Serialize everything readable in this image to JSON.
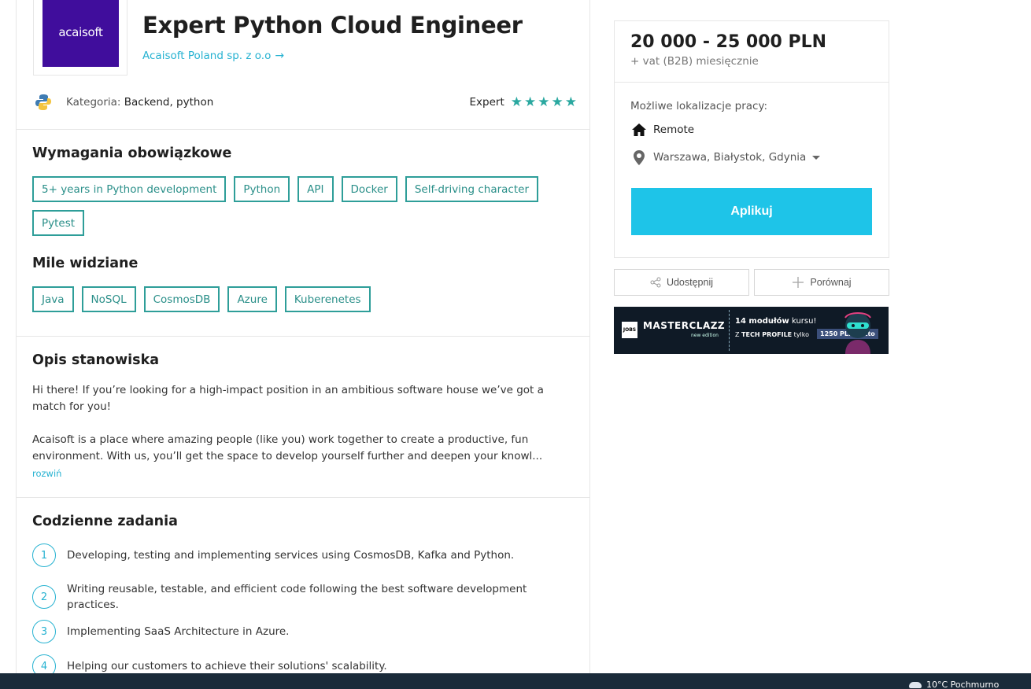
{
  "job": {
    "logo_text": "acaisoft",
    "title": "Expert Python Cloud Engineer",
    "company": "Acaisoft Poland sp. z o.o",
    "category_label": "Kategoria:",
    "category_value": "Backend, python",
    "level": "Expert",
    "level_stars": 5
  },
  "requirements": {
    "title": "Wymagania obowiązkowe",
    "tags": [
      "5+ years in Python development",
      "Python",
      "API",
      "Docker",
      "Self-driving character",
      "Pytest"
    ]
  },
  "nice_to_have": {
    "title": "Mile widziane",
    "tags": [
      "Java",
      "NoSQL",
      "CosmosDB",
      "Azure",
      "Kuberenetes"
    ]
  },
  "description": {
    "title": "Opis stanowiska",
    "p1": "Hi there! If you’re looking for a high-impact position in an ambitious software house we’ve got a match for you!",
    "p2": "Acaisoft is a place where amazing people (like you) work together to create a productive, fun environment. With us, you’ll get the space to develop yourself further and deepen your knowl...",
    "expand": "rozwiń"
  },
  "tasks": {
    "title": "Codzienne zadania",
    "items": [
      {
        "num": "1",
        "text": "Developing, testing and implementing services using CosmosDB, Kafka and Python."
      },
      {
        "num": "2",
        "text": "Writing reusable, testable, and efficient code following the best software development practices."
      },
      {
        "num": "3",
        "text": "Implementing SaaS Architecture in Azure."
      },
      {
        "num": "4",
        "text": "Helping our customers to achieve their solutions' scalability."
      }
    ]
  },
  "sidebar": {
    "salary": "20 000 - 25 000 PLN",
    "salary_note": "+ vat (B2B) miesięcznie",
    "locations_label": "Możliwe lokalizacje pracy:",
    "remote": "Remote",
    "cities": "Warszawa, Białystok, Gdynia",
    "apply": "Aplikuj",
    "share": "Udostępnij",
    "compare": "Porównaj"
  },
  "banner": {
    "logo": "JOBS",
    "title": "MASTERCLAZZ",
    "edition": "new edition",
    "line1_bold": "14 modułów",
    "line1_rest": " kursu!",
    "line2_pre": "Z ",
    "line2_bold": "TECH PROFILE",
    "line2_post": " tylko",
    "price": "1250 PLN netto"
  },
  "taskbar": {
    "weather": "10°C  Pochmurno"
  },
  "colors": {
    "accent": "#26b2d1",
    "tag_border": "#2e9e99",
    "apply_bg": "#1ec4e8",
    "logo_bg": "#400d9c",
    "star": "#2aa8a0"
  }
}
